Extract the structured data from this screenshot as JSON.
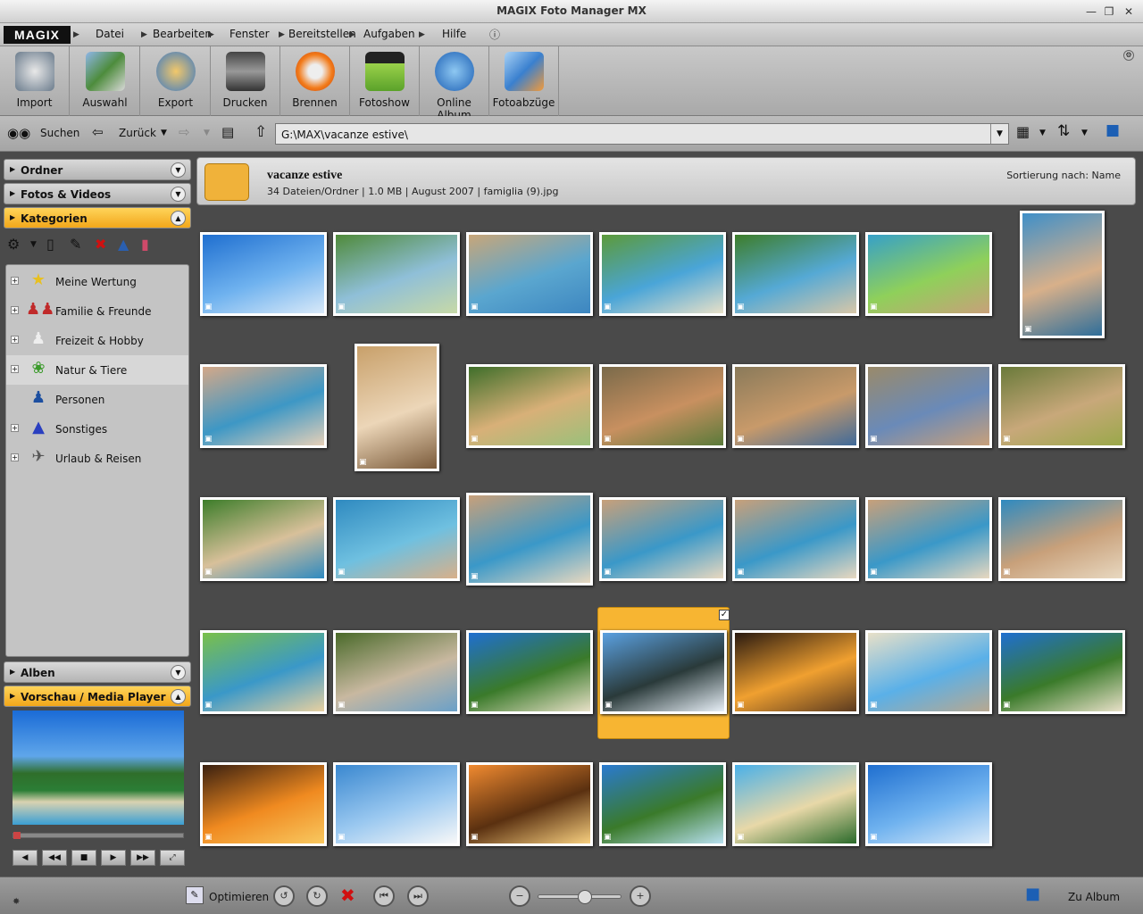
{
  "window": {
    "title": "MAGIX Foto Manager MX"
  },
  "menu": {
    "logo": "MAGIX",
    "items": [
      "Datei",
      "Bearbeiten",
      "Fenster",
      "Bereitstellen",
      "Aufgaben",
      "Hilfe"
    ]
  },
  "toolbar": {
    "buttons": [
      "Import",
      "Auswahl",
      "Export",
      "Drucken",
      "Brennen",
      "Fotoshow",
      "Online Album",
      "Fotoabzüge"
    ]
  },
  "nav": {
    "search": "Suchen",
    "back": "Zurück",
    "path": "G:\\MAX\\vacanze estive\\"
  },
  "sidebar": {
    "ordner": "Ordner",
    "fotos": "Fotos & Videos",
    "kategorien": "Kategorien",
    "categories": [
      "Meine Wertung",
      "Familie & Freunde",
      "Freizeit & Hobby",
      "Natur & Tiere",
      "Personen",
      "Sonstiges",
      "Urlaub & Reisen"
    ],
    "alben": "Alben",
    "vorschau": "Vorschau / Media Player"
  },
  "folder": {
    "title": "vacanze estive",
    "info": "34 Dateien/Ordner | 1.0 MB | August 2007 | famiglia (9).jpg",
    "sort": "Sortierung nach: Name"
  },
  "bottom": {
    "optimize": "Optimieren",
    "album": "Zu Album"
  },
  "colors": {
    "accent": "#f7b532",
    "background": "#4a4a4a"
  }
}
